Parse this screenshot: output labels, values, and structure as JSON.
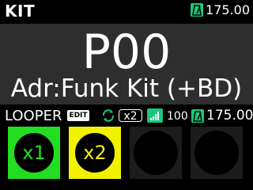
{
  "header": {
    "title": "KIT",
    "tempo": "175.00"
  },
  "patch": {
    "number": "P00",
    "name": "Adr:Funk Kit (+BD)"
  },
  "looper": {
    "label": "LOOPER",
    "edit_label": "EDIT",
    "multiplier": "x2",
    "level": "100",
    "tempo": "175.00"
  },
  "pads": [
    {
      "label": "x1",
      "color": "#22dd22"
    },
    {
      "label": "x2",
      "color": "#f2f200"
    },
    {
      "label": "",
      "color": "#1c1c1c"
    },
    {
      "label": "",
      "color": "#1c1c1c"
    }
  ],
  "colors": {
    "accent": "#19c77e",
    "panel": "#2e2e2e"
  }
}
